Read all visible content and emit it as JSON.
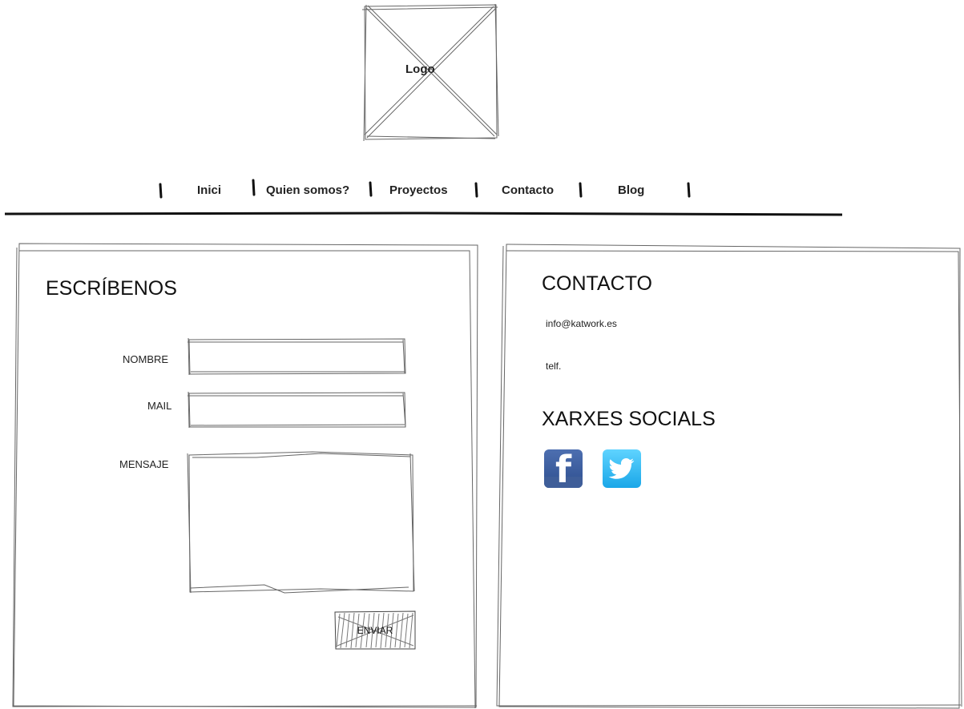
{
  "logo": {
    "label": "Logo"
  },
  "nav": {
    "items": [
      {
        "label": "Inici"
      },
      {
        "label": "Quien somos?"
      },
      {
        "label": "Proyectos"
      },
      {
        "label": "Contacto"
      },
      {
        "label": "Blog"
      }
    ]
  },
  "form": {
    "heading": "ESCRÍBENOS",
    "name_label": "NOMBRE",
    "name_value": "",
    "mail_label": "MAIL",
    "mail_value": "",
    "message_label": "MENSAJE",
    "message_value": "",
    "submit_label": "ENVIAR"
  },
  "contact": {
    "heading": "CONTACTO",
    "email": "info@katwork.es",
    "phone": "telf.",
    "social_heading": "XARXES SOCIALS",
    "social_icons": [
      "facebook-icon",
      "twitter-icon"
    ]
  },
  "colors": {
    "sketch_line": "#555555",
    "facebook": "#3b5998",
    "twitter": "#1da1f2"
  }
}
